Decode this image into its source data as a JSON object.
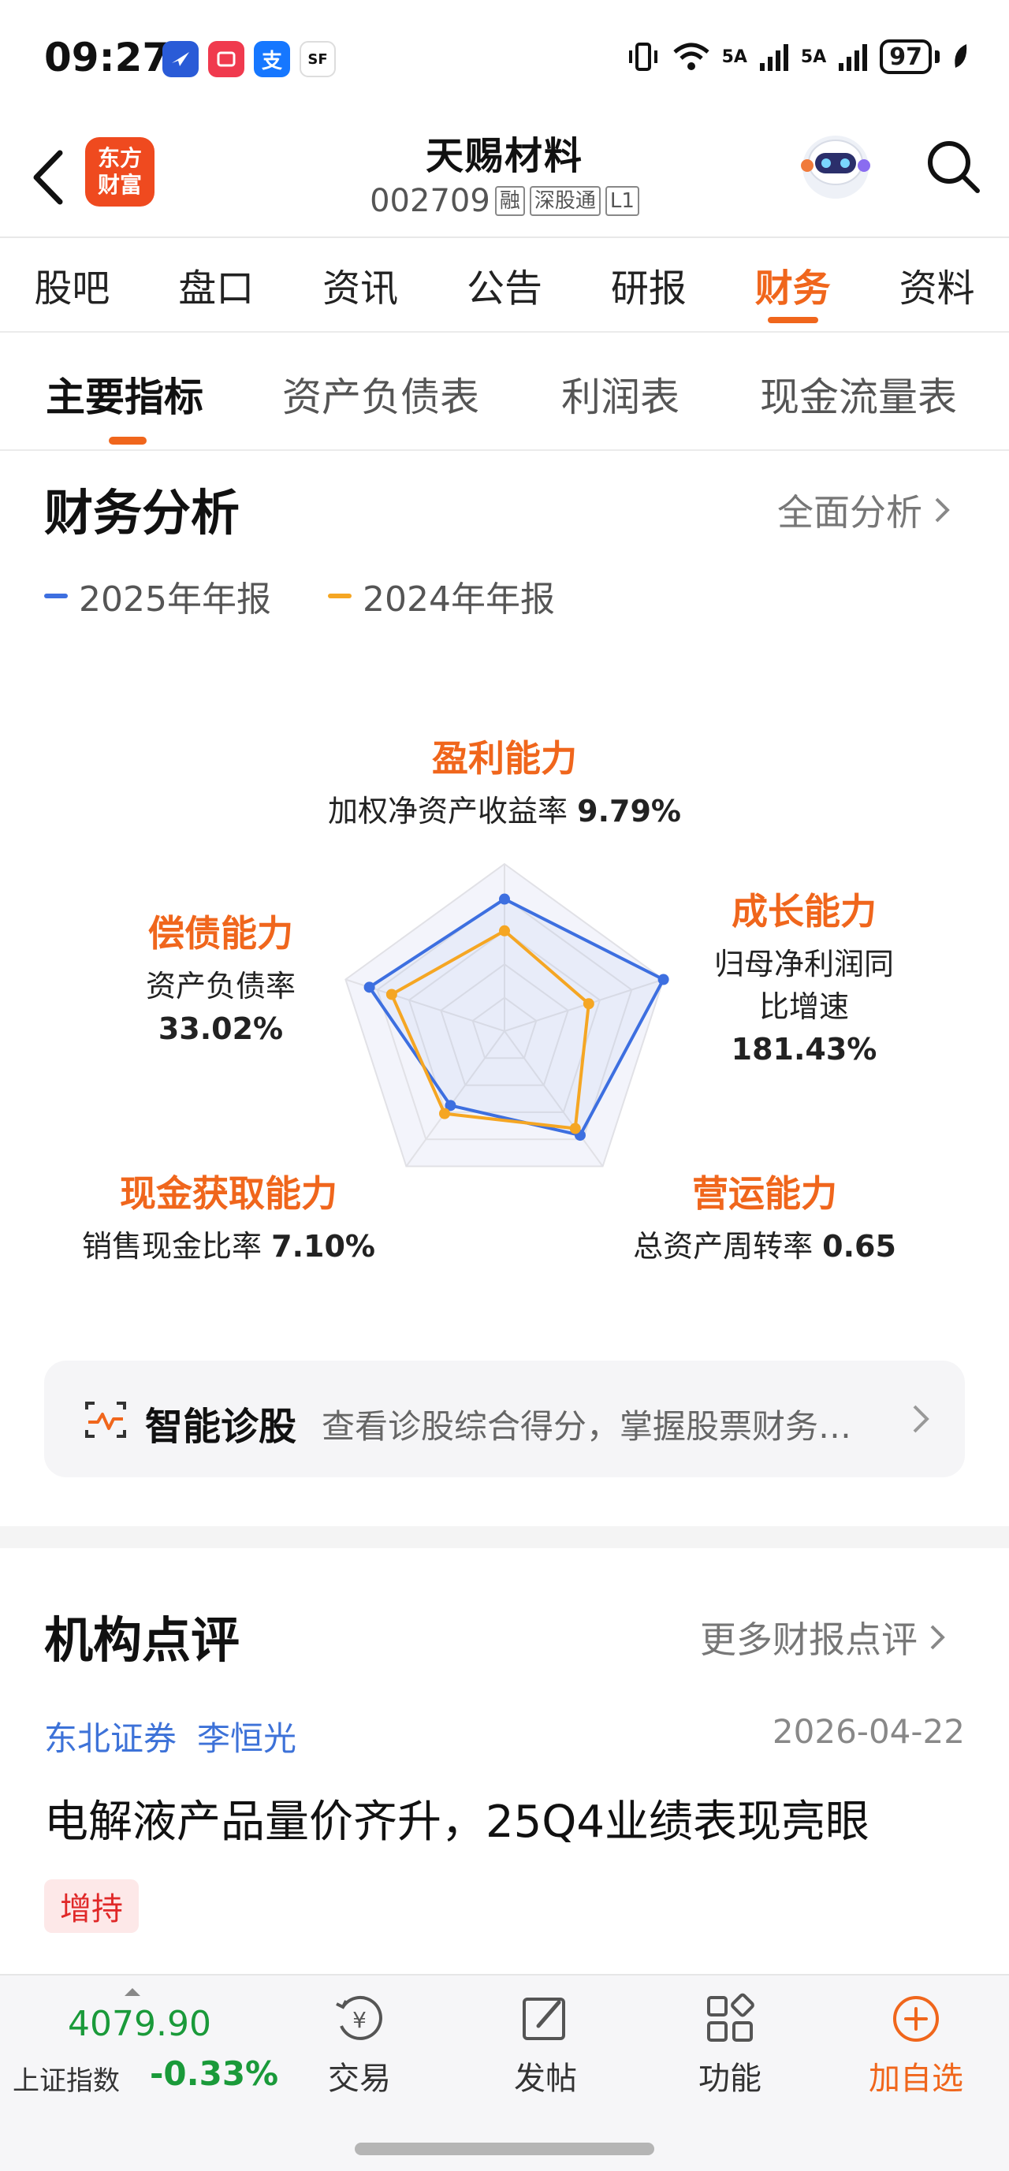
{
  "status_bar": {
    "time": "09:27",
    "signal_1": "5A",
    "signal_2": "5A",
    "battery": "97",
    "app_icons": [
      "app-icon-bird",
      "app-icon-book",
      "alipay-icon",
      "sf-express-icon"
    ],
    "alipay_glyph": "支",
    "sf_glyph": "SF"
  },
  "header": {
    "brand_line1": "东方",
    "brand_line2": "财富",
    "stock_name": "天赐材料",
    "stock_code": "002709",
    "tags": [
      "融",
      "深股通",
      "L1"
    ]
  },
  "nav_tabs": [
    "股吧",
    "盘口",
    "资讯",
    "公告",
    "研报",
    "财务",
    "资料"
  ],
  "nav_active_index": 5,
  "sub_tabs": [
    "主要指标",
    "资产负债表",
    "利润表",
    "现金流量表"
  ],
  "sub_active_index": 0,
  "analysis": {
    "title": "财务分析",
    "more_link": "全面分析",
    "legend": [
      {
        "label": "2025年年报",
        "color": "#3d6fe0"
      },
      {
        "label": "2024年年报",
        "color": "#f5a623"
      }
    ],
    "labels": {
      "profit": {
        "category": "盈利能力",
        "metric": "加权净资产收益率",
        "value": "9.79%"
      },
      "growth": {
        "category": "成长能力",
        "metric_line1": "归母净利润同",
        "metric_line2": "比增速",
        "value": "181.43%"
      },
      "operation": {
        "category": "营运能力",
        "metric": "总资产周转率",
        "value": "0.65"
      },
      "cash": {
        "category": "现金获取能力",
        "metric": "销售现金比率",
        "value": "7.10%"
      },
      "debt": {
        "category": "偿债能力",
        "metric": "资产负债率",
        "value": "33.02%"
      }
    }
  },
  "chart_data": {
    "type": "radar",
    "axes": [
      "盈利能力",
      "成长能力",
      "营运能力",
      "现金获取能力",
      "偿债能力"
    ],
    "range": [
      0,
      1
    ],
    "grid_levels": 5,
    "series": [
      {
        "name": "2025年年报",
        "color": "#3d6fe0",
        "values": [
          0.79,
          1.0,
          0.77,
          0.55,
          0.85
        ]
      },
      {
        "name": "2024年年报",
        "color": "#f5a623",
        "values": [
          0.6,
          0.53,
          0.72,
          0.61,
          0.71
        ]
      }
    ]
  },
  "diagnosis": {
    "title": "智能诊股",
    "description": "查看诊股综合得分，掌握股票财务…"
  },
  "reviews": {
    "title": "机构点评",
    "more_link": "更多财报点评",
    "item": {
      "broker": "东北证券",
      "analyst": "李恒光",
      "date": "2026-04-22",
      "headline": "电解液产品量价齐升，25Q4业绩表现亮眼",
      "rating": "增持"
    }
  },
  "bottom_bar": {
    "index_price": "4079.90",
    "index_name": "上证指数",
    "index_change": "-0.33%",
    "items": [
      {
        "label": "交易",
        "icon": "trade-icon"
      },
      {
        "label": "发帖",
        "icon": "post-icon"
      },
      {
        "label": "功能",
        "icon": "apps-icon"
      },
      {
        "label": "加自选",
        "icon": "add-circle-icon"
      }
    ]
  },
  "colors": {
    "accent": "#f0661c",
    "link": "#3d72d8",
    "down": "#1a9a3a"
  }
}
